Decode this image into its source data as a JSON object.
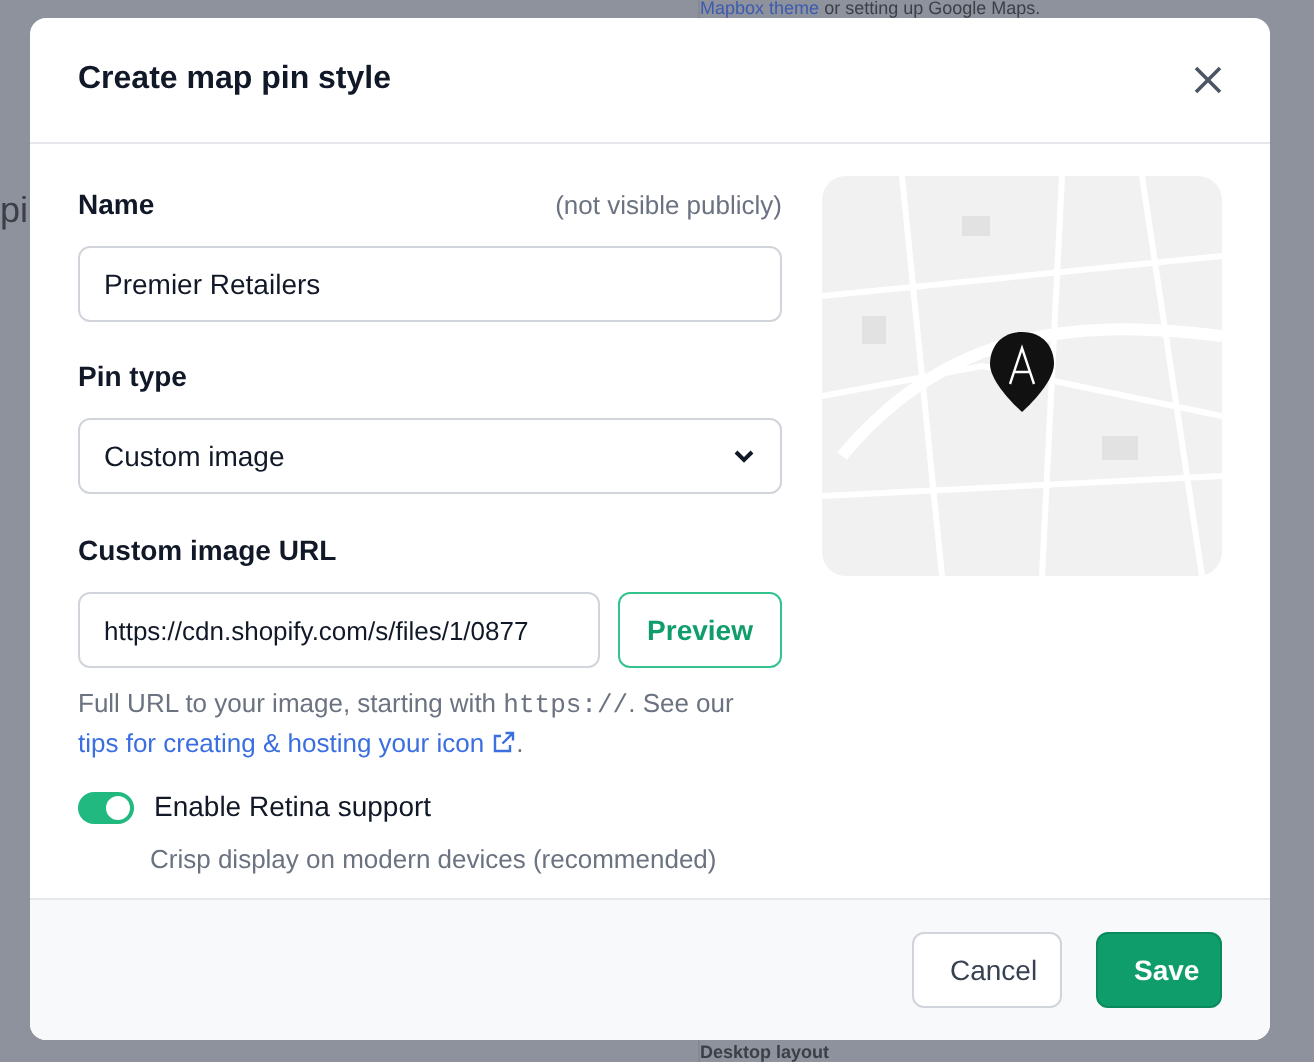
{
  "background": {
    "link": "Mapbox theme",
    "link_suffix": "or setting up Google Maps.",
    "left_heading": "pi",
    "section_label": "Desktop layout"
  },
  "dialog": {
    "title": "Create map pin style",
    "name_field": {
      "label": "Name",
      "hint": "(not visible publicly)",
      "value": "Premier Retailers"
    },
    "pin_type": {
      "label": "Pin type",
      "value": "Custom image"
    },
    "url_field": {
      "label": "Custom image URL",
      "value": "https://cdn.shopify.com/s/files/1/0877",
      "button": "Preview"
    },
    "help": {
      "before": "Full URL to your image, starting with",
      "code": "https://",
      "after": ". See our",
      "link": "tips for creating & hosting your icon",
      "end": "."
    },
    "retina": {
      "label": "Enable Retina support",
      "description": "Crisp display on modern devices (recommended)",
      "on": true
    },
    "buttons": [
      {
        "label": "Cancel",
        "kind": "secondary"
      },
      {
        "label": "Save",
        "kind": "primary"
      }
    ]
  }
}
